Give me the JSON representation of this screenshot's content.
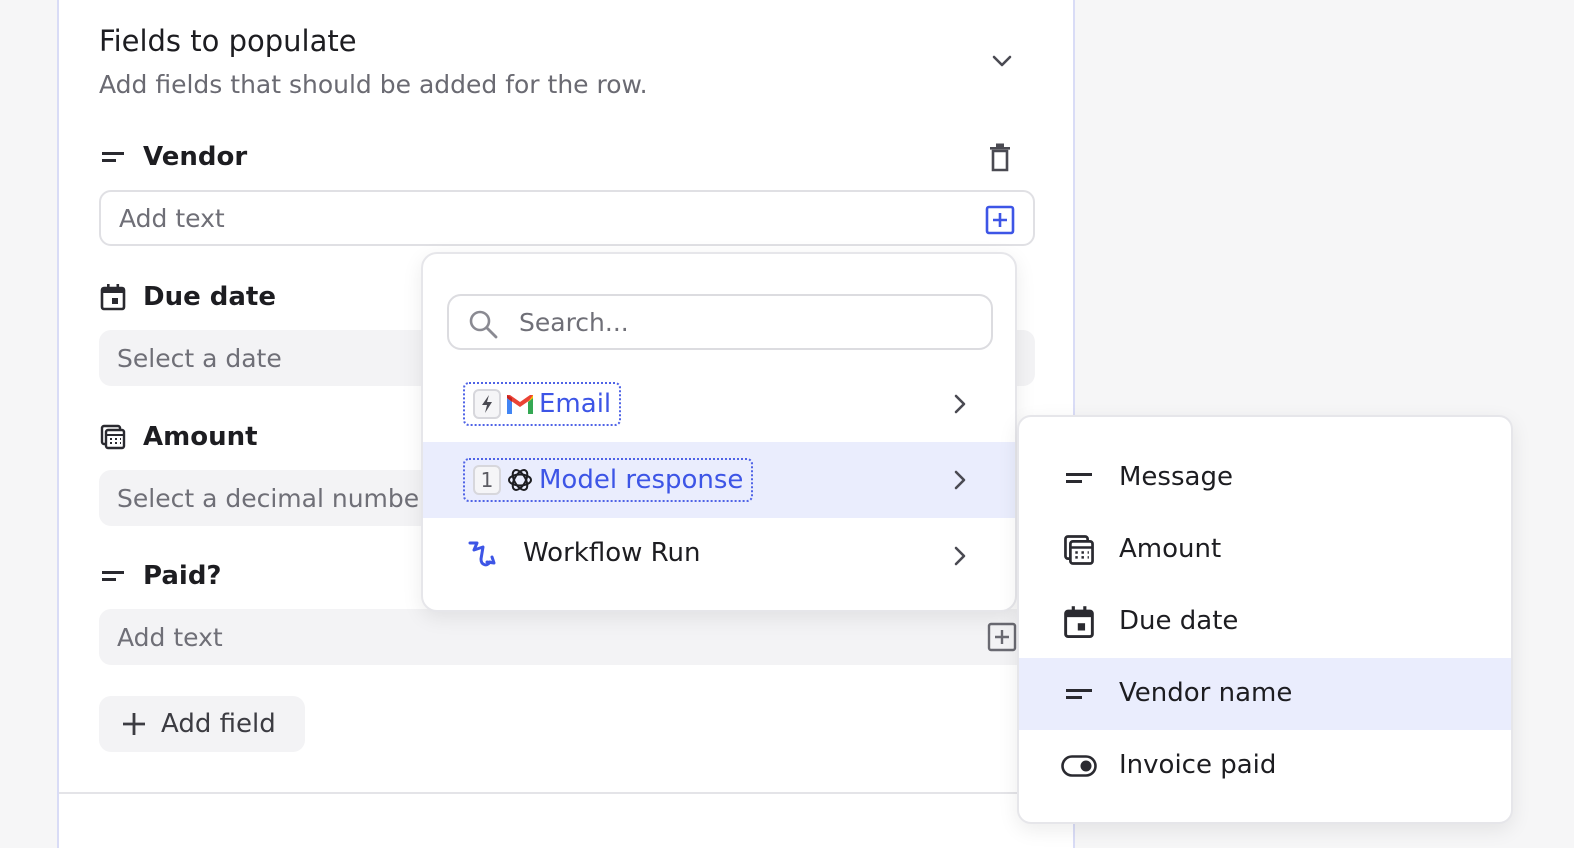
{
  "section": {
    "title": "Fields to populate",
    "subtitle": "Add fields that should be added for the row."
  },
  "fields": [
    {
      "label": "Vendor",
      "icon": "text-lines-icon",
      "placeholder": "Add text"
    },
    {
      "label": "Due date",
      "icon": "calendar-icon",
      "placeholder": "Select a date"
    },
    {
      "label": "Amount",
      "icon": "calculator-icon",
      "placeholder": "Select a decimal number"
    },
    {
      "label": "Paid?",
      "icon": "text-lines-icon",
      "placeholder": "Add text"
    }
  ],
  "add_field_label": "Add field",
  "dropdown": {
    "search_placeholder": "Search...",
    "items": [
      {
        "label": "Email",
        "badge_icon": "lightning-icon",
        "logo": "gmail-icon"
      },
      {
        "label": "Model response",
        "badge": "1",
        "logo": "openai-icon"
      },
      {
        "label": "Workflow Run",
        "icon": "workflow-icon"
      }
    ]
  },
  "submenu": {
    "items": [
      {
        "label": "Message",
        "icon": "text-lines-icon"
      },
      {
        "label": "Amount",
        "icon": "calculator-icon"
      },
      {
        "label": "Due date",
        "icon": "calendar-icon"
      },
      {
        "label": "Vendor name",
        "icon": "text-lines-icon"
      },
      {
        "label": "Invoice paid",
        "icon": "toggle-icon"
      }
    ]
  },
  "colors": {
    "accent": "#3d55e6",
    "highlight": "#eaedfd",
    "panel_border": "#d9dcf6"
  }
}
